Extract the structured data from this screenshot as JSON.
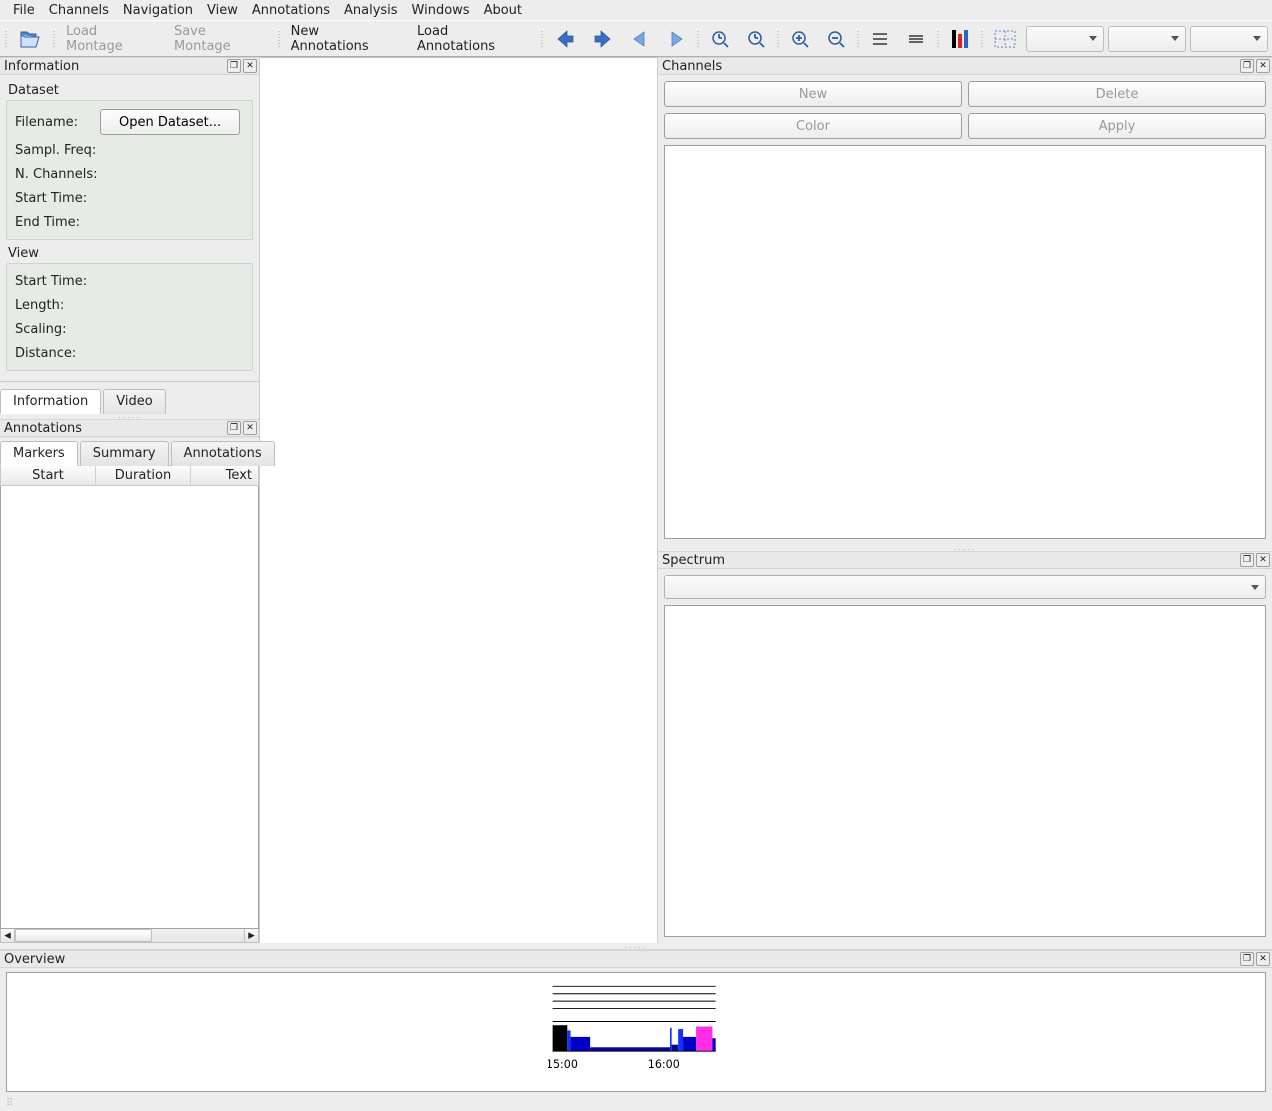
{
  "menubar": [
    "File",
    "Channels",
    "Navigation",
    "View",
    "Annotations",
    "Analysis",
    "Windows",
    "About"
  ],
  "toolbar": {
    "load_montage": "Load Montage",
    "save_montage": "Save Montage",
    "new_annotations": "New Annotations",
    "load_annotations": "Load Annotations"
  },
  "info_panel": {
    "title": "Information",
    "dataset_label": "Dataset",
    "filename_label": "Filename:",
    "open_dataset": "Open Dataset...",
    "sampl_freq": "Sampl. Freq:",
    "n_channels": "N. Channels:",
    "start_time": "Start Time:",
    "end_time": "End Time:",
    "view_label": "View",
    "v_start_time": "Start Time:",
    "v_length": "Length:",
    "v_scaling": "Scaling:",
    "v_distance": "Distance:",
    "tabs": {
      "information": "Information",
      "video": "Video"
    }
  },
  "annot_panel": {
    "title": "Annotations",
    "tabs": {
      "markers": "Markers",
      "summary": "Summary",
      "annotations": "Annotations"
    },
    "cols": {
      "start": "Start",
      "duration": "Duration",
      "text": "Text"
    }
  },
  "channels_panel": {
    "title": "Channels",
    "new": "New",
    "delete": "Delete",
    "color": "Color",
    "apply": "Apply"
  },
  "spectrum_panel": {
    "title": "Spectrum"
  },
  "overview_panel": {
    "title": "Overview"
  },
  "chart_data": {
    "type": "timeline",
    "x_ticks": [
      "15:00",
      "16:00"
    ],
    "segments": [
      {
        "start": 0.0,
        "end": 0.09,
        "color": "#000000",
        "height": 1.0
      },
      {
        "start": 0.09,
        "end": 0.11,
        "color": "#1230ff",
        "height": 0.8
      },
      {
        "start": 0.11,
        "end": 0.23,
        "color": "#0000c6",
        "height": 0.55
      },
      {
        "start": 0.23,
        "end": 0.72,
        "color": "#050a8a",
        "height": 0.15
      },
      {
        "start": 0.72,
        "end": 0.73,
        "color": "#1230ff",
        "height": 0.9
      },
      {
        "start": 0.73,
        "end": 0.77,
        "color": "#050a8a",
        "height": 0.25
      },
      {
        "start": 0.77,
        "end": 0.8,
        "color": "#1230ff",
        "height": 0.85
      },
      {
        "start": 0.8,
        "end": 0.88,
        "color": "#0000c6",
        "height": 0.55
      },
      {
        "start": 0.88,
        "end": 0.98,
        "color": "#ff2ee6",
        "height": 0.95
      },
      {
        "start": 0.98,
        "end": 1.0,
        "color": "#0000c6",
        "height": 0.5
      }
    ]
  }
}
